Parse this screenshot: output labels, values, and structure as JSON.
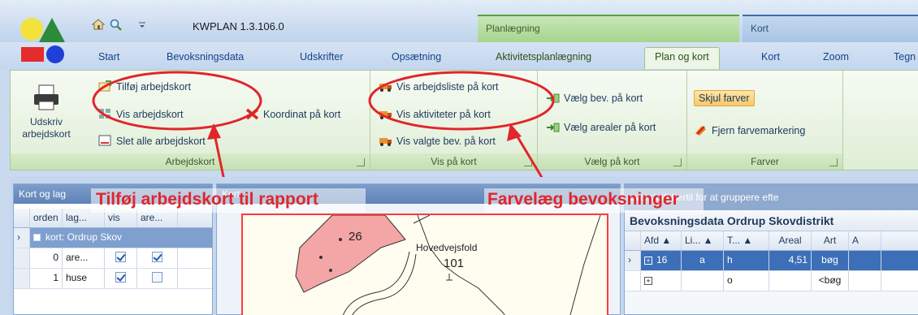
{
  "app": {
    "title": "KWPLAN 1.3.106.0",
    "context_plan": "Planlægning",
    "context_kort": "Kort"
  },
  "tabs": [
    "Start",
    "Bevoksningsdata",
    "Udskrifter",
    "Opsætning",
    "Aktivitetsplanlægning",
    "Plan og kort",
    "Kort",
    "Zoom",
    "Tegn"
  ],
  "active_tab": "Plan og kort",
  "ribbon": {
    "arbejdskort": {
      "label": "Arbejdskort",
      "udskriv": "Udskriv",
      "udskriv2": "arbejdskort",
      "tilfoj": "Tilføj arbejdskort",
      "vis": "Vis arbejdskort",
      "slet": "Slet alle arbejdskort",
      "koordinat": "Koordinat på kort"
    },
    "vis_paa_kort": {
      "label": "Vis på kort",
      "arbejdsliste": "Vis arbejdsliste på kort",
      "aktiviteter": "Vis aktiviteter på kort",
      "valgte": "Vis valgte bev. på kort"
    },
    "vaelg_paa_kort": {
      "label": "Vælg på kort",
      "bev": "Vælg bev. på kort",
      "arealer": "Vælg arealer på kort"
    },
    "farver": {
      "label": "Farver",
      "skjul": "Skjul farver",
      "fjern": "Fjern farvemarkering"
    }
  },
  "layers_panel": {
    "title": "Kort og lag",
    "columns": [
      "orden",
      "lag...",
      "vis",
      "are..."
    ],
    "group_row": "kort: Ordrup Skov",
    "rows": [
      {
        "orden": "0",
        "lag": "are...",
        "vis": true,
        "are": true
      },
      {
        "orden": "1",
        "lag": "huse",
        "vis": true,
        "are": false
      }
    ]
  },
  "map_panel": {
    "title": "Kort",
    "label_26": "26",
    "place": "Hovedvejsfold",
    "parcel": "101"
  },
  "data_panel": {
    "group_hint": "overskrift hertil for at gruppere efte",
    "title": "Bevoksningsdata Ordrup Skovdistrikt",
    "columns": [
      "Afd ▲",
      "Li... ▲",
      "T... ▲",
      "Areal",
      "Art",
      "A"
    ],
    "rows": [
      {
        "afd": "16",
        "li": "a",
        "t": "h",
        "areal": "4,51",
        "art": "bøg",
        "selected": true
      },
      {
        "afd": "",
        "li": "",
        "t": "o",
        "areal": "",
        "art": "<bøg",
        "selected": false
      }
    ]
  },
  "annotations": {
    "left": "Tilføj arbejdskort til rapport",
    "right": "Farvelæg bevoksninger"
  },
  "colors": {
    "annotation_red": "#e0262b",
    "selected_row": "#3d6fb8",
    "context_green": "#a6d48d"
  }
}
